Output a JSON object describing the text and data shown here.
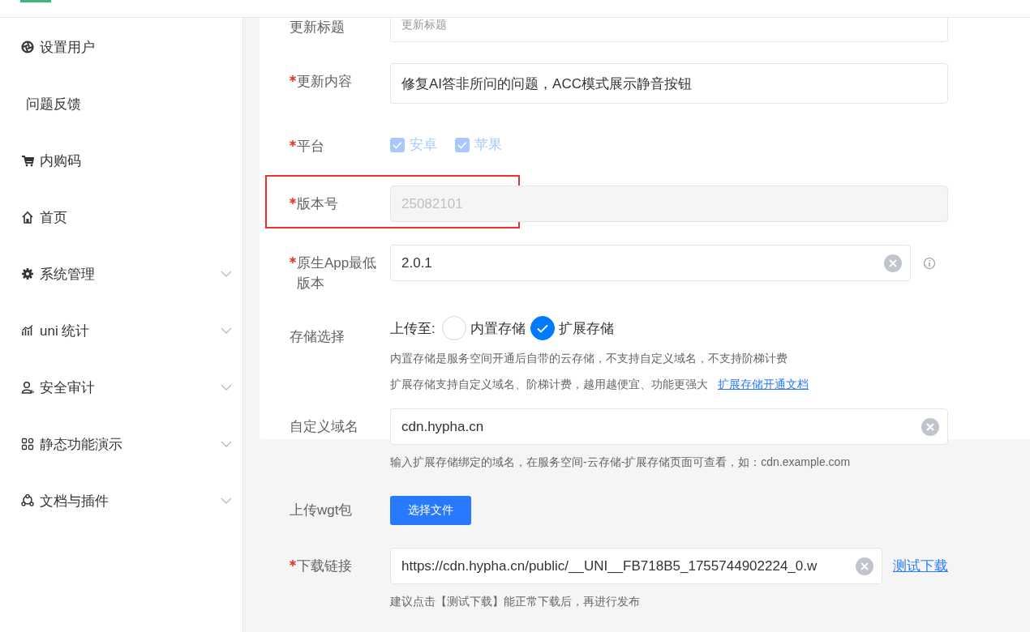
{
  "sidebar": {
    "items": [
      {
        "label": "设置用户",
        "expandable": false
      },
      {
        "label": "问题反馈",
        "expandable": false
      },
      {
        "label": "内购码",
        "expandable": false
      },
      {
        "label": "首页",
        "expandable": false
      },
      {
        "label": "系统管理",
        "expandable": true
      },
      {
        "label": "uni 统计",
        "expandable": true
      },
      {
        "label": "安全审计",
        "expandable": true
      },
      {
        "label": "静态功能演示",
        "expandable": true
      },
      {
        "label": "文档与插件",
        "expandable": true
      }
    ]
  },
  "form": {
    "rows": [
      {
        "kind": "input",
        "label": "更新标题",
        "required": false,
        "placeholder": "更新标题"
      },
      {
        "kind": "input",
        "label": "更新内容",
        "required": true,
        "value": "修复AI答非所问的问题，ACC模式展示静音按钮",
        "tall": true
      },
      {
        "kind": "checkboxes",
        "label": "平台",
        "required": true,
        "disabled": true,
        "options": [
          {
            "label": "安卓",
            "checked": true
          },
          {
            "label": "苹果",
            "checked": true
          }
        ]
      },
      {
        "kind": "input",
        "label": "版本号",
        "required": true,
        "value": "25082101",
        "disabled": true,
        "highlighted": true
      },
      {
        "kind": "input",
        "label": "原生App最低版本",
        "required": true,
        "value": "2.0.1",
        "clearable": true,
        "info": true
      },
      {
        "kind": "radio",
        "label": "存储选择",
        "required": false,
        "prefix": "上传至:",
        "options": [
          {
            "label": "内置存储",
            "selected": false
          },
          {
            "label": "扩展存储",
            "selected": true
          }
        ],
        "hints": [
          {
            "text": "内置存储是服务空间开通后自带的云存储，不支持自定义域名，不支持阶梯计费"
          },
          {
            "text": "扩展存储支持自定义域名、阶梯计费，越用越便宜、功能更强大",
            "link": "扩展存储开通文档"
          }
        ]
      },
      {
        "kind": "input",
        "label": "自定义域名",
        "required": false,
        "value": "cdn.hypha.cn",
        "clearable": true,
        "hint": "输入扩展存储绑定的域名，在服务空间-云存储-扩展存储页面可查看，如：cdn.example.com"
      },
      {
        "kind": "button",
        "label": "上传wgt包",
        "required": false,
        "button": "选择文件"
      },
      {
        "kind": "input",
        "label": "下载链接",
        "required": true,
        "value": "https://cdn.hypha.cn/public/__UNI__FB718B5_1755744902224_0.w",
        "clearable": true,
        "link": "测试下载",
        "hint": "建议点击【测试下载】能正常下载后，再进行发布"
      }
    ]
  }
}
